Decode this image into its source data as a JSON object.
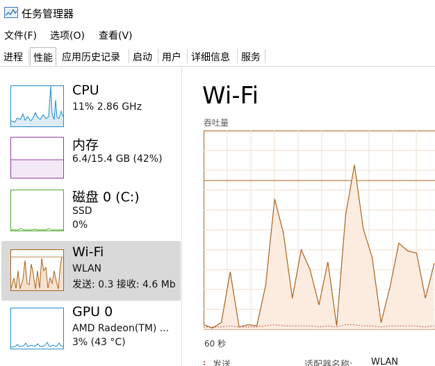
{
  "window": {
    "title": "任务管理器"
  },
  "menu": [
    "文件(F)",
    "选项(O)",
    "查看(V)"
  ],
  "tabs": [
    "进程",
    "性能",
    "应用历史记录",
    "启动",
    "用户",
    "详细信息",
    "服务"
  ],
  "active_tab": "性能",
  "sidebar": {
    "items": [
      {
        "name": "CPU",
        "sub1": "11% 2.86 GHz",
        "sub2": "",
        "color": "#1c8bc8"
      },
      {
        "name": "内存",
        "sub1": "6.4/15.4 GB (42%)",
        "sub2": "",
        "color": "#8e3fa0"
      },
      {
        "name": "磁盘 0 (C:)",
        "sub1": "SSD",
        "sub2": "0%",
        "color": "#4da82b"
      },
      {
        "name": "Wi-Fi",
        "sub1": "WLAN",
        "sub2": "发送: 0.3  接收: 4.6 Mb",
        "color": "#a8621c"
      },
      {
        "name": "GPU 0",
        "sub1": "AMD Radeon(TM) ...",
        "sub2": "3% (43 °C)",
        "color": "#1c8bc8"
      }
    ],
    "selected_index": 3
  },
  "main": {
    "title": "Wi-Fi",
    "graph_label": "吞吐量",
    "time_label": "60 秒",
    "send_label": "发送",
    "adapter_label": "适配器名称:",
    "adapter_value": "WLAN"
  },
  "chart_data": {
    "type": "area",
    "title": "",
    "xlabel": "60 秒",
    "ylabel": "吞吐量",
    "series": [
      {
        "name": "接收",
        "values": [
          0.4,
          0.1,
          0.6,
          5.2,
          0.2,
          0.4,
          0.3,
          4.0,
          11.8,
          8.7,
          2.8,
          7.2,
          5.4,
          2.2,
          6.1,
          0.3,
          10.3,
          14.9,
          9.1,
          6.5,
          0.6,
          3.8,
          7.8,
          7.1,
          6.9,
          2.8,
          6.0
        ]
      },
      {
        "name": "发送",
        "values": [
          0.2,
          0.2,
          0.2,
          0.3,
          0.2,
          0.2,
          0.2,
          0.3,
          0.4,
          0.3,
          0.3,
          0.3,
          0.3,
          0.2,
          0.3,
          0.2,
          0.4,
          0.4,
          0.3,
          0.3,
          0.2,
          0.3,
          0.3,
          0.3,
          0.3,
          0.2,
          0.3
        ]
      }
    ],
    "grid": true,
    "color": "#a8621c"
  }
}
